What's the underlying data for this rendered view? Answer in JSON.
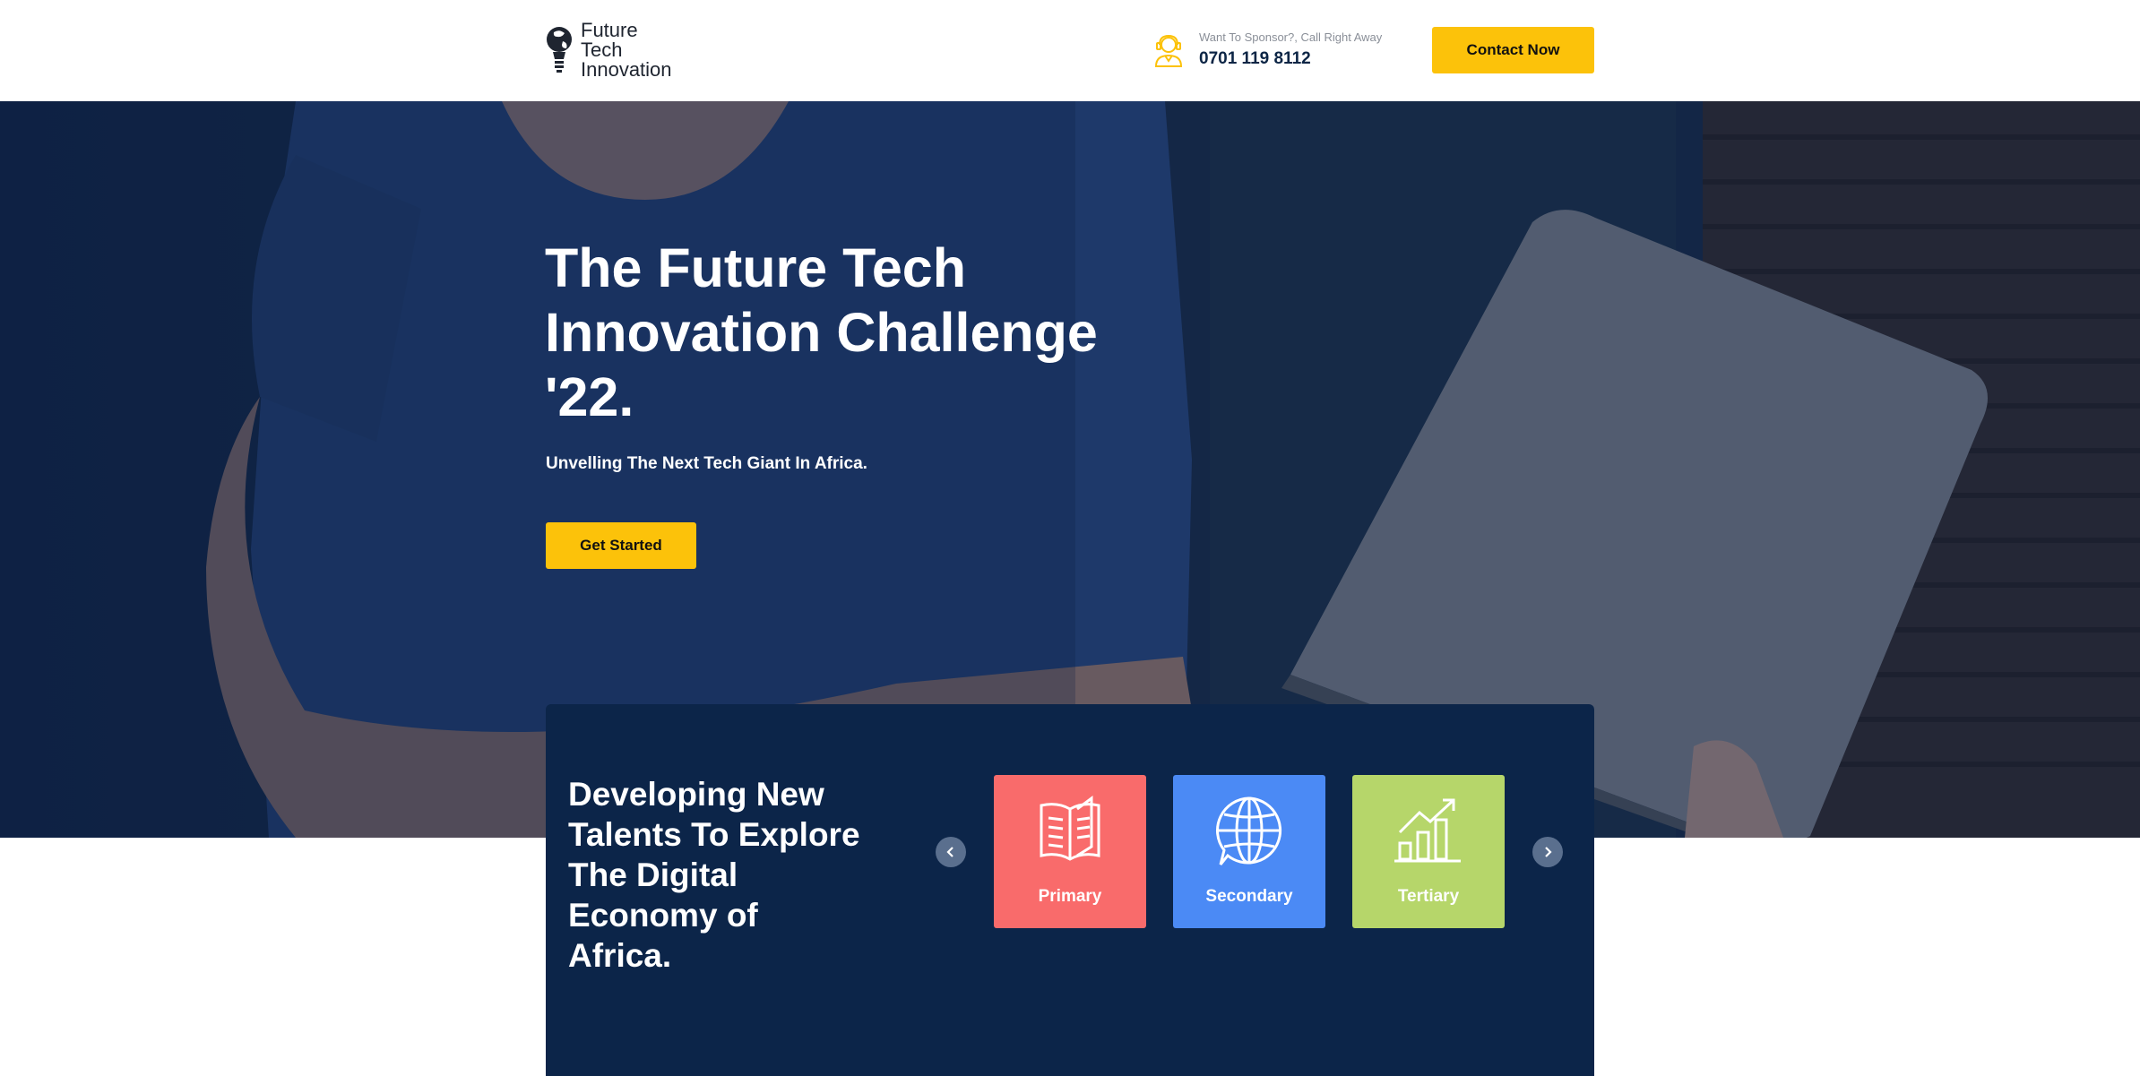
{
  "header": {
    "logo_lines": [
      "Future",
      "Tech",
      "Innovation"
    ],
    "sponsor_label": "Want To Sponsor?, Call Right Away",
    "sponsor_phone": "0701 119 8112",
    "contact_label": "Contact Now"
  },
  "hero": {
    "title": "The Future Tech Innovation Challenge '22.",
    "subtitle": "Unvelling The Next Tech Giant In Africa.",
    "cta_label": "Get Started"
  },
  "panel": {
    "title": "Developing New Talents To Explore The Digital Economy of Africa.",
    "cards": [
      {
        "label": "Primary",
        "icon": "book-icon",
        "color": "#f96b6b"
      },
      {
        "label": "Secondary",
        "icon": "globe-chat-icon",
        "color": "#4b8af5"
      },
      {
        "label": "Tertiary",
        "icon": "growth-chart-icon",
        "color": "#b6d66a"
      }
    ]
  },
  "colors": {
    "accent": "#fcc20a",
    "navy": "#0c2549"
  }
}
